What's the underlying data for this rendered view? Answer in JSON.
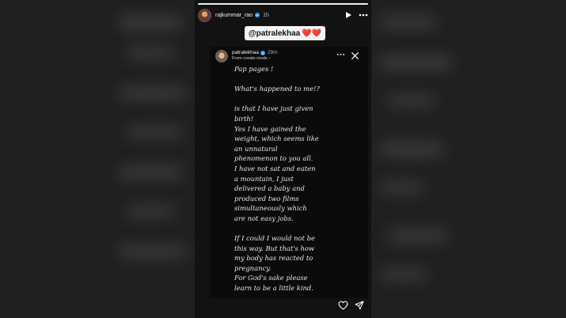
{
  "story": {
    "username": "rajkummar_rao",
    "time": "1h",
    "mention": "@patralekhaa",
    "mention_emoji": "❤️❤️"
  },
  "reshared": {
    "username": "patralekhaa",
    "time": "29m",
    "subtitle": "From create mode ›"
  },
  "note_lines": [
    "Pap pages !",
    "",
    "What's happened to me!?",
    "",
    "is that I have just given",
    "birth!",
    "Yes I have gained the",
    "weight, which seems like",
    "an unnatural",
    "phenomenon to you all.",
    "I have not sat and eaten",
    "a mountain, I just",
    "delivered a baby and",
    "produced two films",
    "simultaneously which",
    "are not easy jobs.",
    "",
    "If I could I would not be",
    "this way. But that's how",
    "my body has reacted to",
    "pregnancy.",
    "For God's sake please",
    "learn to be a little kind."
  ],
  "icons": {
    "play": "play-icon",
    "more": "more-icon",
    "close": "close-icon",
    "heart": "heart-icon",
    "send": "send-icon",
    "verified": "verified-badge-icon"
  },
  "colors": {
    "story_bg": "#121212",
    "text": "#e6e6e6",
    "mention_bg": "#f5f5f5",
    "verified": "#3897f0"
  }
}
